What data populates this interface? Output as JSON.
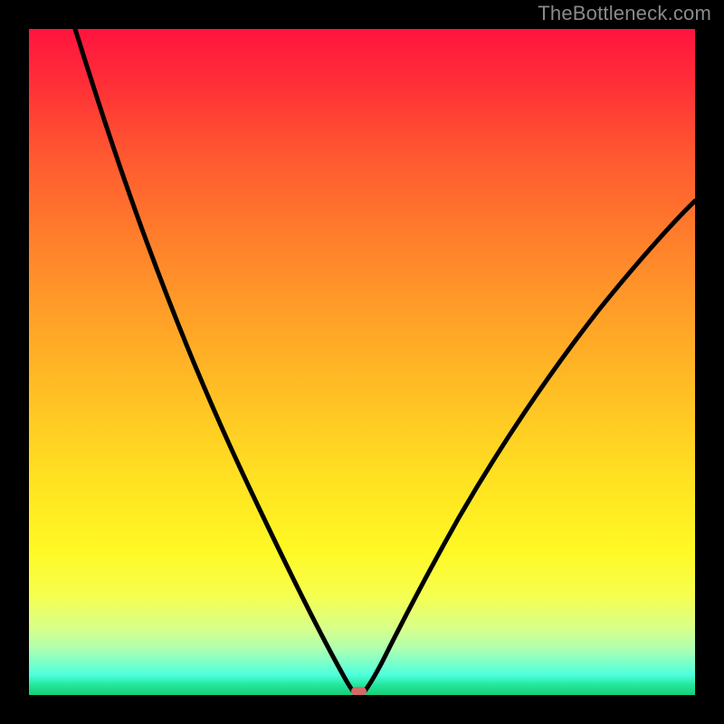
{
  "watermark": "TheBottleneck.com",
  "colors": {
    "frame": "#000000",
    "curve": "#000000",
    "marker": "#d46a66"
  },
  "chart_data": {
    "type": "line",
    "title": "",
    "xlabel": "",
    "ylabel": "",
    "xlim": [
      0,
      100
    ],
    "ylim": [
      0,
      100
    ],
    "grid": false,
    "legend": false,
    "series": [
      {
        "name": "bottleneck-curve",
        "x": [
          7,
          10,
          15,
          20,
          25,
          30,
          35,
          40,
          45,
          47,
          48,
          49,
          50,
          52,
          55,
          58,
          62,
          68,
          75,
          82,
          90,
          100
        ],
        "y": [
          100,
          94,
          83,
          72,
          61,
          50,
          39,
          27,
          12,
          5,
          2,
          0,
          0.5,
          3,
          8,
          14,
          21,
          30,
          40,
          49,
          58,
          68
        ]
      }
    ],
    "marker": {
      "x": 49,
      "y": 0,
      "shape": "rounded-rect"
    },
    "background_gradient": [
      {
        "stop": 0,
        "color": "#ff143e"
      },
      {
        "stop": 0.5,
        "color": "#ffd424"
      },
      {
        "stop": 0.85,
        "color": "#fff823"
      },
      {
        "stop": 1,
        "color": "#18cd77"
      }
    ]
  }
}
